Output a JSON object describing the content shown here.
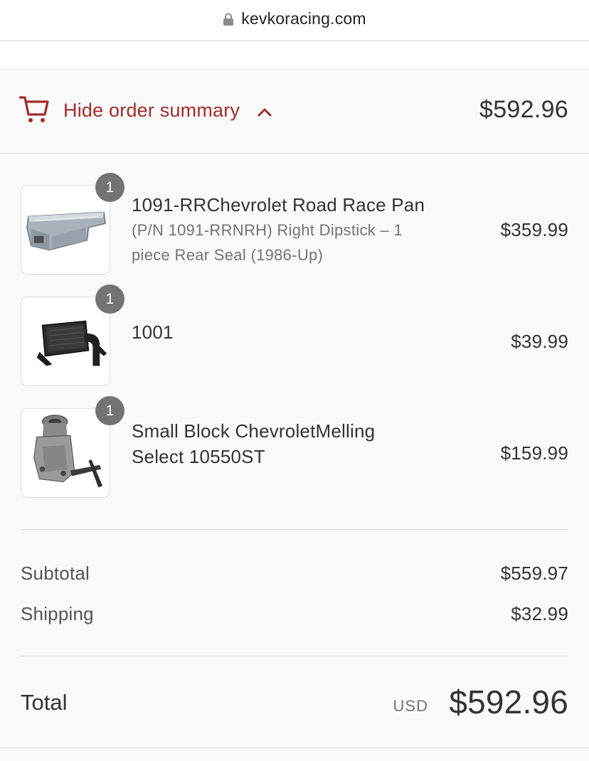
{
  "browser": {
    "url": "kevkoracing.com"
  },
  "summary_toggle": {
    "label": "Hide order summary",
    "total": "$592.96"
  },
  "line_items": [
    {
      "quantity": "1",
      "name": "1091-RRChevrolet Road Race Pan",
      "variant_line1": "(P/N 1091-RRNRH) Right Dipstick – 1",
      "variant_line2": "piece Rear Seal (1986-Up)",
      "price": "$359.99"
    },
    {
      "quantity": "1",
      "name": "1001",
      "price": "$39.99"
    },
    {
      "quantity": "1",
      "name_line1": "Small Block ChevroletMelling",
      "name_line2": "Select 10550ST",
      "price": "$159.99"
    }
  ],
  "totals": {
    "subtotal_label": "Subtotal",
    "subtotal_value": "$559.97",
    "shipping_label": "Shipping",
    "shipping_value": "$32.99",
    "total_label": "Total",
    "currency": "USD",
    "total_value": "$592.96"
  },
  "colors": {
    "accent": "#a52a2a",
    "badge": "#737373",
    "background": "#fafafa"
  },
  "icons": {
    "lock": "lock-icon",
    "cart": "cart-icon",
    "toggle": "chevron-up-icon"
  }
}
